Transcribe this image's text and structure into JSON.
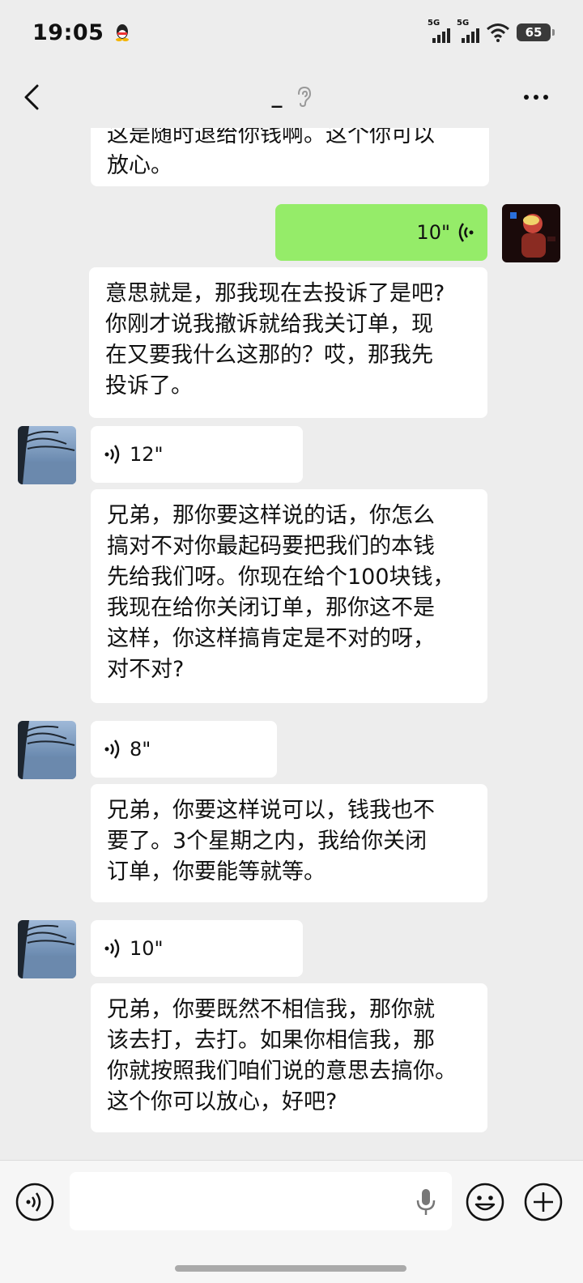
{
  "status_bar": {
    "time": "19:05",
    "network1": "5G",
    "network2": "5G",
    "battery": "65"
  },
  "header": {
    "title": "_"
  },
  "messages": [
    {
      "side": "them",
      "type": "text",
      "lines": [
        "这是随时退给你钱啊。这个你可以",
        "放心。"
      ]
    },
    {
      "side": "me",
      "type": "voice",
      "duration": "10\""
    },
    {
      "side": "them",
      "type": "text",
      "lines": [
        "意思就是，那我现在去投诉了是吧?",
        "你刚才说我撤诉就给我关订单，现",
        "在又要我什么这那的？哎，那我先",
        "投诉了。"
      ]
    },
    {
      "side": "them",
      "type": "voice",
      "duration": "12\""
    },
    {
      "side": "them",
      "type": "text",
      "lines": [
        "兄弟，那你要这样说的话，你怎么",
        "搞对不对你最起码要把我们的本钱",
        "先给我们呀。你现在给个100块钱，",
        "我现在给你关闭订单，那你这不是",
        "这样，你这样搞肯定是不对的呀，",
        "对不对?"
      ]
    },
    {
      "side": "them",
      "type": "voice",
      "duration": "8\""
    },
    {
      "side": "them",
      "type": "text",
      "lines": [
        "兄弟，你要这样说可以，钱我也不",
        "要了。3个星期之内，我给你关闭",
        "订单，你要能等就等。"
      ]
    },
    {
      "side": "them",
      "type": "voice",
      "duration": "10\""
    },
    {
      "side": "them",
      "type": "text",
      "lines": [
        "兄弟，你要既然不相信我，那你就",
        "该去打，去打。如果你相信我，那",
        "你就按照我们咱们说的意思去搞你。",
        "这个你可以放心，好吧?"
      ]
    }
  ],
  "input_bar": {
    "icons": [
      "voice-mode-icon",
      "microphone-icon",
      "emoji-icon",
      "plus-icon"
    ]
  },
  "colors": {
    "background": "#ededed",
    "my_bubble": "#95ec69",
    "their_bubble": "#ffffff"
  }
}
